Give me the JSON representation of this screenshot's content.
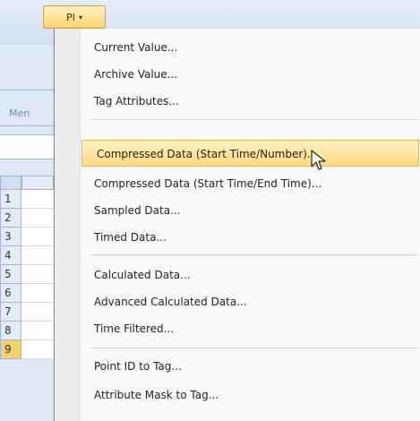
{
  "ribbon": {
    "pi_button_label": "PI",
    "pi_button_caret": "▾",
    "partial_tab_label": "Men"
  },
  "sheet": {
    "row_numbers": [
      "1",
      "2",
      "3",
      "4",
      "5",
      "6",
      "7",
      "8",
      "9"
    ],
    "active_row": "9"
  },
  "menu": {
    "items": [
      {
        "label": "Current Value..."
      },
      {
        "label": "Archive Value..."
      },
      {
        "label": "Tag Attributes..."
      },
      {
        "label": "Compressed Data (Start Time/Number)..."
      },
      {
        "label": "Compressed Data (Start Time/End Time)..."
      },
      {
        "label": "Sampled Data..."
      },
      {
        "label": "Timed Data..."
      },
      {
        "label": "Calculated Data..."
      },
      {
        "label": "Advanced Calculated Data..."
      },
      {
        "label": "Time Filtered..."
      },
      {
        "label": "Point ID to Tag..."
      },
      {
        "label": "Attribute Mask to Tag..."
      }
    ]
  },
  "colors": {
    "highlight": "#ffd87a",
    "active_row": "#f6cf6e"
  },
  "icons": {
    "cursor": "mouse-pointer-icon"
  }
}
